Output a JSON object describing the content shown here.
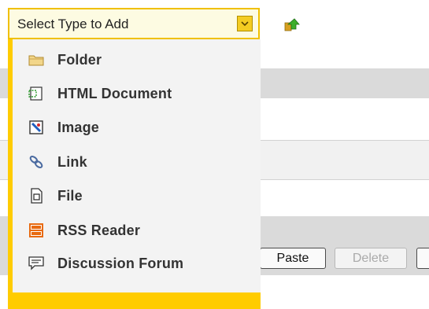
{
  "dropdown": {
    "label": "Select Type to Add",
    "arrow_icon": "chevron-down-icon",
    "accent_color": "#ffcc00",
    "items": [
      {
        "label": "Folder",
        "icon": "folder-icon"
      },
      {
        "label": "HTML Document",
        "icon": "html-document-icon"
      },
      {
        "label": "Image",
        "icon": "image-icon"
      },
      {
        "label": "Link",
        "icon": "link-icon"
      },
      {
        "label": "File",
        "icon": "file-icon"
      },
      {
        "label": "RSS Reader",
        "icon": "rss-icon"
      },
      {
        "label": "Discussion Forum",
        "icon": "discussion-forum-icon"
      }
    ]
  },
  "toolbar": {
    "up_icon": "up-folder-icon",
    "paste_label": "Paste",
    "delete_label": "Delete"
  }
}
